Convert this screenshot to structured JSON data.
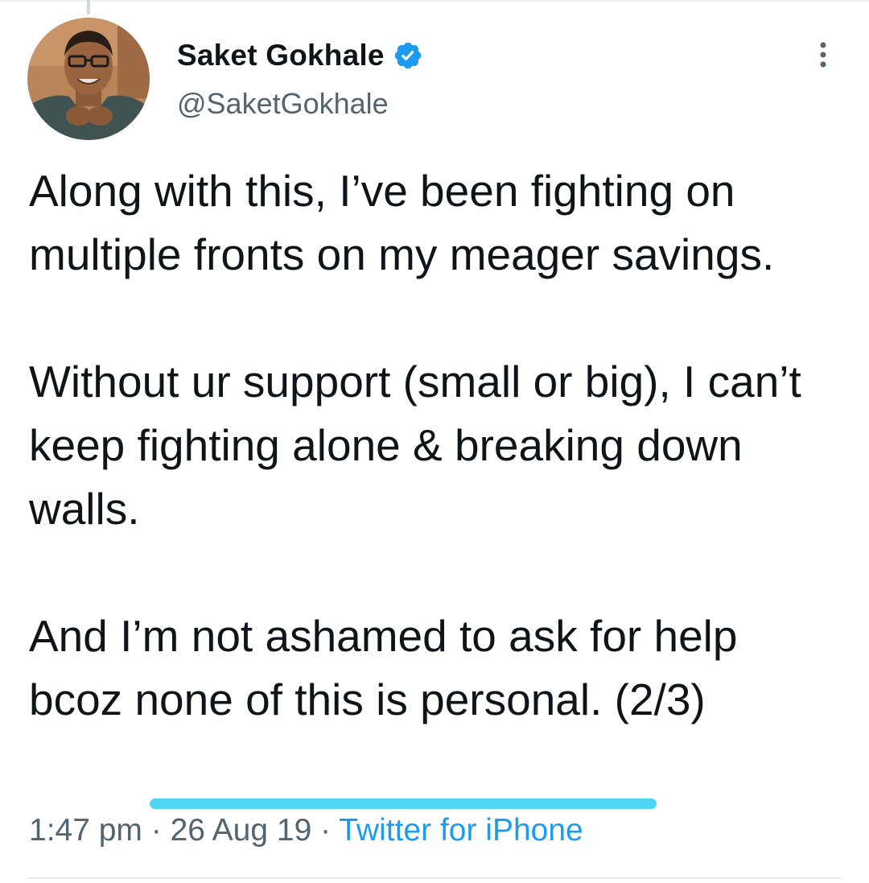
{
  "author": {
    "name": "Saket Gokhale",
    "handle": "@SaketGokhale",
    "verified_icon": "verified-badge-icon",
    "verified_color": "#1d9bf0"
  },
  "tweet": {
    "paragraphs": [
      "Along with this, I’ve been fighting on multiple fronts on my meager savings.",
      "Without ur support (small or big), I can’t keep fighting alone & breaking down walls.",
      "And I’m not ashamed to ask for help bcoz none of this is personal. (2/3)"
    ]
  },
  "meta": {
    "time": "1:47 pm",
    "separator": "·",
    "date": "26 Aug 19",
    "source": "Twitter for iPhone",
    "source_color": "#1d9bf0"
  },
  "menu": {
    "icon": "more-options-icon"
  },
  "annotation": {
    "highlight_color": "#4dd6f5"
  }
}
